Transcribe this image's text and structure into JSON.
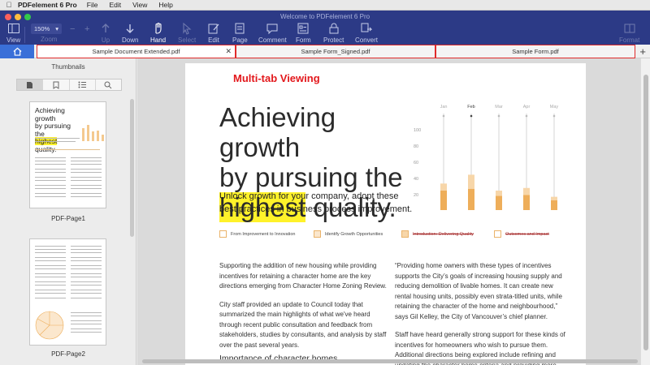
{
  "menubar": {
    "app_name": "PDFelement 6 Pro",
    "items": [
      "File",
      "Edit",
      "View",
      "Help"
    ]
  },
  "window": {
    "title": "Welcome to PDFelement 6 Pro"
  },
  "toolbar": {
    "view": "View",
    "zoom_value": "150%",
    "zoom_label": "Zoom",
    "up": "Up",
    "down": "Down",
    "hand": "Hand",
    "select": "Select",
    "edit": "Edit",
    "page": "Page",
    "comment": "Comment",
    "form": "Form",
    "protect": "Protect",
    "convert": "Convert",
    "format": "Format"
  },
  "tabs": [
    {
      "label": "Sample Document Extended.pdf",
      "active": true
    },
    {
      "label": "Sample Form_Signed.pdf",
      "active": false
    },
    {
      "label": "Sample Form.pdf",
      "active": false
    }
  ],
  "left_panel": {
    "title": "Thumbnails",
    "pages": [
      "PDF-Page1",
      "PDF-Page2"
    ]
  },
  "annotation": "Multi-tab Viewing",
  "document": {
    "headline_1": "Achieving growth",
    "headline_2": "by pursuing the",
    "headline_3a": "highest",
    "headline_3b": " quality.",
    "subhead": "Unlock growth for your company, adopt these best practices in business process improvement.",
    "legend": [
      "From Improvement to Innovation",
      "Identify Growth Opportunities",
      "Introduction: Delivering Quality",
      "Outcomes and Impact"
    ],
    "col1_p1": "Supporting the addition of new housing while providing incentives for retaining a character home are the key directions emerging from Character Home Zoning Review.",
    "col1_p2": "City staff provided an update to Council today that summarized the main highlights of what we've heard through recent public consultation and feedback from stakeholders, studies by consultants, and analysis by staff over the past several years.",
    "col1_heading": "Importance of character homes",
    "col2_p1": "“Providing home owners with these types of incentives supports the City’s goals of increasing housing supply and reducing demolition of livable homes.  It can create new rental housing units, possibly even strata-titled units, while retaining the character of the home and neighbourhood,” says Gil Kelley, the City of Vancouver’s chief planner.",
    "col2_p2": "Staff have heard generally strong support for these kinds of incentives for homeowners who wish to pursue them. Additional directions being explored include refining and updating the character home criteria and providing more"
  },
  "chart_data": {
    "type": "bar",
    "categories": [
      "Jan",
      "Feb",
      "Mar",
      "Apr",
      "May"
    ],
    "yticks": [
      "100",
      "80",
      "60",
      "40",
      "20"
    ],
    "ylim": [
      0,
      100
    ],
    "series": [
      {
        "values": [
          30,
          40,
          22,
          25,
          15
        ]
      },
      {
        "values": [
          22,
          24,
          16,
          17,
          11
        ]
      }
    ],
    "colors": {
      "light": "#f7d6a9",
      "dark": "#eeae5a",
      "axis": "#b7b7b7"
    }
  },
  "colors": {
    "toolbar_bg": "#2c3a86",
    "tab_highlight": "#e02a2a",
    "home_button": "#3a6fd8",
    "annotation": "#e3181c",
    "highlight": "#fff22a"
  }
}
